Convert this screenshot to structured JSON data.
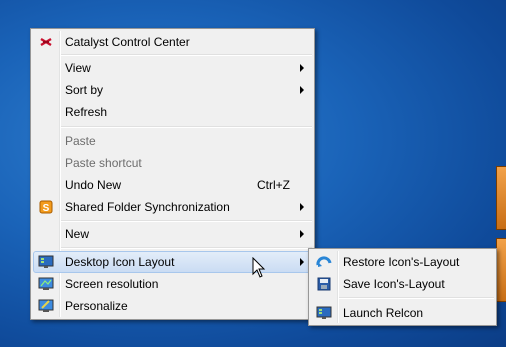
{
  "context_menu": {
    "items": [
      {
        "label": "Catalyst Control Center",
        "icon": "catalyst-icon"
      },
      {
        "label": "View"
      },
      {
        "label": "Sort by"
      },
      {
        "label": "Refresh"
      },
      {
        "label": "Paste"
      },
      {
        "label": "Paste shortcut"
      },
      {
        "label": "Undo New",
        "shortcut": "Ctrl+Z"
      },
      {
        "label": "Shared Folder Synchronization",
        "icon": "sync-icon"
      },
      {
        "label": "New"
      },
      {
        "label": "Desktop Icon Layout",
        "icon": "desktop-layout-icon"
      },
      {
        "label": "Screen resolution",
        "icon": "monitor-icon"
      },
      {
        "label": "Personalize",
        "icon": "personalize-icon"
      }
    ]
  },
  "submenu": {
    "items": [
      {
        "label": "Restore Icon's-Layout",
        "icon": "restore-icon"
      },
      {
        "label": "Save Icon's-Layout",
        "icon": "save-icon"
      },
      {
        "label": "Launch Relcon",
        "icon": "relcon-icon"
      }
    ]
  },
  "colors": {
    "desktop": "#1a63b8",
    "menu_bg": "#f0f0f0",
    "highlight": "#cadcf3"
  }
}
